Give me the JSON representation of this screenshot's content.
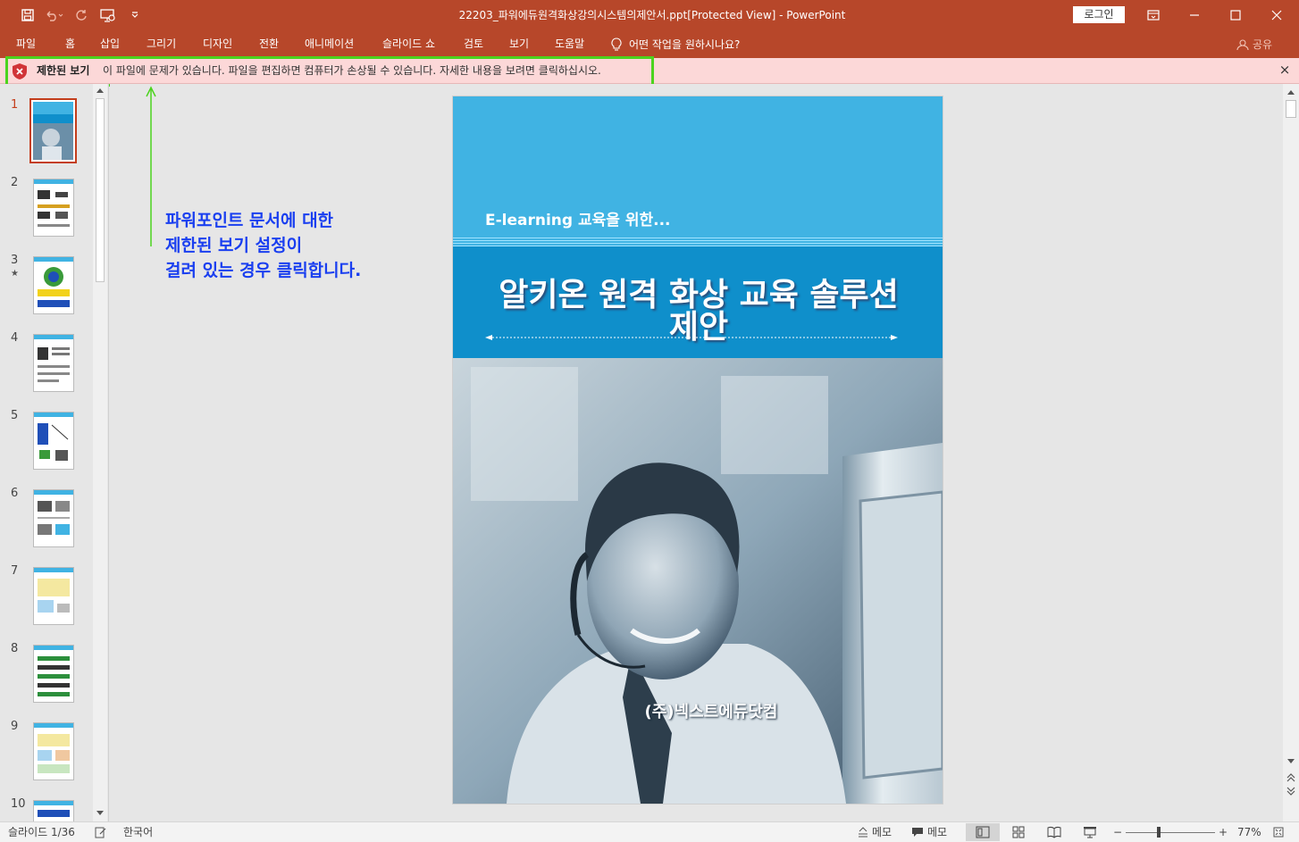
{
  "window": {
    "title": "22203_파워에듀원격화상강의시스템의제안서.ppt[Protected View]  -  PowerPoint",
    "login_label": "로그인"
  },
  "ribbon": {
    "tabs": [
      "파일",
      "홈",
      "삽입",
      "그리기",
      "디자인",
      "전환",
      "애니메이션",
      "슬라이드 쇼",
      "검토",
      "보기",
      "도움말"
    ],
    "tell_me": "어떤 작업을 원하시나요?",
    "share": "공유"
  },
  "protected_view": {
    "title": "제한된 보기",
    "message": "이 파일에 문제가 있습니다. 파일을 편집하면 컴퓨터가 손상될 수 있습니다. 자세한 내용을 보려면 클릭하십시오.",
    "close": "×"
  },
  "thumbnails": [
    {
      "num": "1",
      "active": true
    },
    {
      "num": "2"
    },
    {
      "num": "3",
      "star": "★"
    },
    {
      "num": "4"
    },
    {
      "num": "5"
    },
    {
      "num": "6"
    },
    {
      "num": "7"
    },
    {
      "num": "8"
    },
    {
      "num": "9"
    },
    {
      "num": "10"
    }
  ],
  "slide": {
    "subtitle": "E-learning 교육을 위한...",
    "title": "알키온 원격 화상 교육 솔루션 제안",
    "company": "(주)넥스트에듀닷컴",
    "colors": {
      "top": "#40b3e3",
      "band": "#0f8fcb"
    }
  },
  "annotation": {
    "lines": [
      "파워포인트 문서에 대한",
      "제한된 보기 설정이",
      "걸려 있는 경우 클릭합니다."
    ],
    "color": "#1a3ff0",
    "highlight_color": "#4cd31e"
  },
  "status": {
    "slide_counter": "슬라이드 1/36",
    "language": "한국어",
    "notes": "메모",
    "comments": "메모",
    "zoom": "77%"
  }
}
